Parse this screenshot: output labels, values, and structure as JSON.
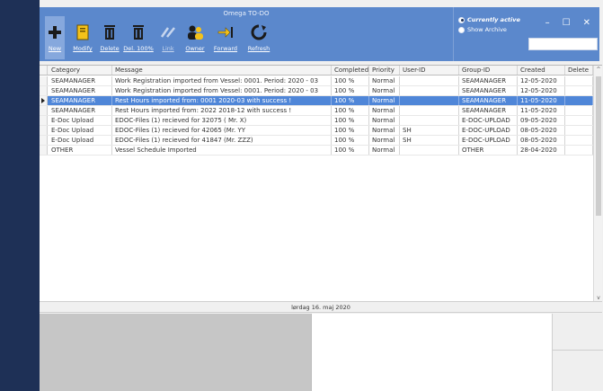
{
  "window": {
    "title": "Omega TO-DO",
    "controls": [
      "–",
      "☐",
      "✕"
    ]
  },
  "toolbar": {
    "buttons": [
      {
        "label": "New",
        "icon": "plus-icon",
        "active": true
      },
      {
        "label": "Modify",
        "icon": "notepad-icon"
      },
      {
        "label": "Delete",
        "icon": "trash-icon"
      },
      {
        "label": "Del. 100%",
        "icon": "trash-icon"
      },
      {
        "label": "Link",
        "icon": "link-icon",
        "disabled": true
      },
      {
        "label": "Owner",
        "icon": "people-icon"
      },
      {
        "label": "Forward",
        "icon": "forward-arrow-icon"
      },
      {
        "label": "Refresh",
        "icon": "refresh-icon"
      }
    ]
  },
  "filter": {
    "currently_active": "Currently active",
    "show_archive": "Show Archive"
  },
  "search": {
    "value": ""
  },
  "grid": {
    "headers": [
      "Category",
      "Message",
      "Completed",
      "Priority",
      "User-ID",
      "Group-ID",
      "Created",
      "Delete"
    ],
    "rows": [
      [
        "SEAMANAGER",
        "Work Registration imported from Vessel: 0001. Period: 2020 - 03",
        "100 %",
        "Normal",
        "",
        "SEAMANAGER",
        "12-05-2020",
        ""
      ],
      [
        "SEAMANAGER",
        "Work Registration imported from Vessel: 0001. Period: 2020 - 03",
        "100 %",
        "Normal",
        "",
        "SEAMANAGER",
        "12-05-2020",
        ""
      ],
      [
        "SEAMANAGER",
        "Rest Hours imported from: 0001 2020-03 with success !",
        "100 %",
        "Normal",
        "",
        "SEAMANAGER",
        "11-05-2020",
        ""
      ],
      [
        "SEAMANAGER",
        "Rest Hours imported from: 2022 2018-12 with success !",
        "100 %",
        "Normal",
        "",
        "SEAMANAGER",
        "11-05-2020",
        ""
      ],
      [
        "E-Doc Upload",
        "EDOC-Files (1) recieved for 32075    ( Mr. X)",
        "100 %",
        "Normal",
        "",
        "E-DOC-UPLOAD",
        "09-05-2020",
        ""
      ],
      [
        "E-Doc Upload",
        "EDOC-Files (1) recieved for 42065    (Mr. YY",
        "100 %",
        "Normal",
        "SH",
        "E-DOC-UPLOAD",
        "08-05-2020",
        ""
      ],
      [
        "E-Doc Upload",
        "EDOC-Files (1) recieved for 41847    (Mr. ZZZ)",
        "100 %",
        "Normal",
        "SH",
        "E-DOC-UPLOAD",
        "08-05-2020",
        ""
      ],
      [
        "OTHER",
        "Vessel Schedule Imported",
        "100 %",
        "Normal",
        "",
        "OTHER",
        "28-04-2020",
        ""
      ]
    ],
    "selected_row": 2
  },
  "status": {
    "date": "lørdag 16. maj 2020"
  },
  "scroll": {
    "up": "^",
    "down": "v"
  }
}
